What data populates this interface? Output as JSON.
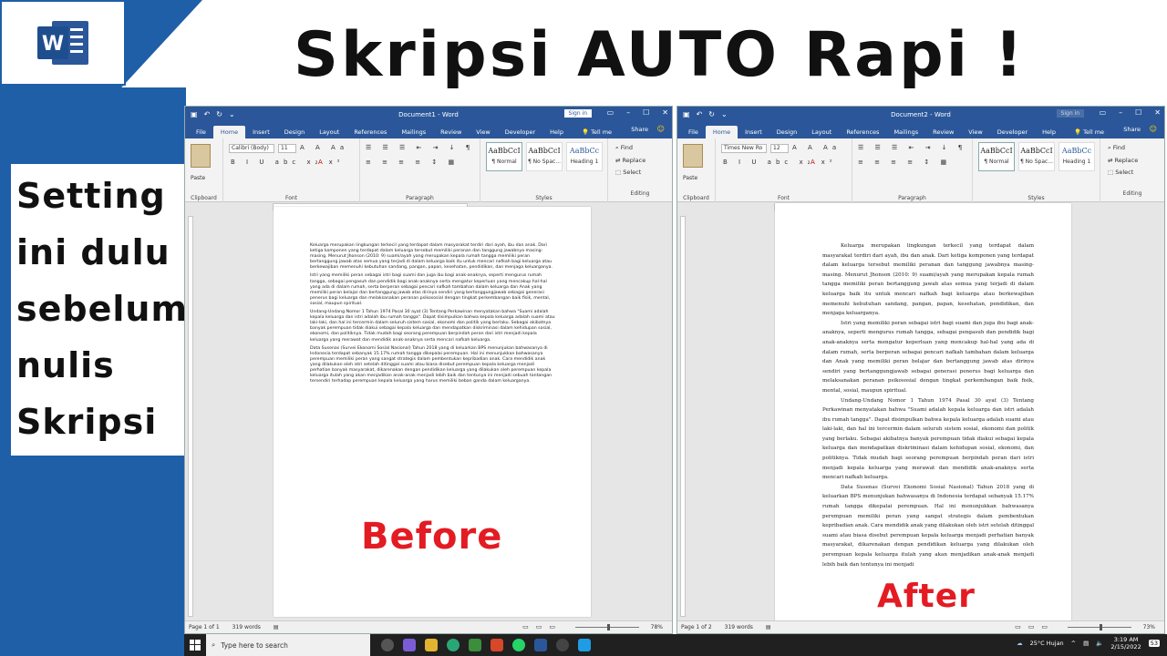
{
  "headline": "Skripsi AUTO Rapi !",
  "sidebar_lines": [
    "Setting",
    "ini dulu",
    "sebelum",
    "nulis",
    "Skripsi"
  ],
  "logo_letter": "W",
  "colors": {
    "word_blue": "#2b579a",
    "band_blue": "#1f5fa8",
    "label_red": "#e31b23",
    "taskbar": "#202020"
  },
  "ribbon_tabs": [
    "File",
    "Home",
    "Insert",
    "Design",
    "Layout",
    "References",
    "Mailings",
    "Review",
    "View",
    "Developer",
    "Help"
  ],
  "ribbon": {
    "tell_me": "Tell me",
    "share": "Share",
    "paste": "Paste",
    "groups": {
      "clipboard": "Clipboard",
      "font": "Font",
      "paragraph": "Paragraph",
      "styles": "Styles",
      "editing": "Editing"
    },
    "styles": [
      {
        "sample": "AaBbCcI",
        "name": "¶ Normal"
      },
      {
        "sample": "AaBbCcI",
        "name": "¶ No Spac..."
      },
      {
        "sample": "AaBbCc",
        "name": "Heading 1"
      }
    ],
    "editing": [
      "Find",
      "Replace",
      "Select"
    ],
    "font_icons": "B I U abc x₂ x²",
    "para_icons": "≡ ≡ ≡ ≡ ↕ ▦"
  },
  "windows": {
    "left": {
      "title": "Document1 - Word",
      "signin": "Sign in",
      "font": "Calibri (Body)",
      "size": "11",
      "status_page": "Page 1 of 1",
      "status_words": "319 words",
      "zoom": "78%",
      "label": "Before",
      "paragraphs": [
        "Keluarga merupakan lingkungan terkecil yang terdapat dalam masyarakat terdiri dari ayah, ibu dan anak. Dari ketiga komponen yang terdapat dalam keluarga tersebut memiliki peranan dan tanggung jawabnya masing-masing. Menurut Jhonson (2010: 9) suami/ayah yang merupakan kepala rumah tangga memiliki peran bertanggung jawab atas semua yang terjadi di dalam keluarga baik itu untuk mencari nafkah bagi keluarga atau berkewajiban memenuhi kebutuhan sandang, pangan, papan, kesehatan, pendidikan, dan menjaga keluarganya.",
        "Istri yang memiliki peran sebagai istri bagi suami dan juga ibu bagi anak-anaknya, seperti mengurus rumah tangga, sebagai pengasuh dan pendidik bagi anak-anaknya serta mengatur keperluan yang mencakup hal-hal yang ada di dalam rumah, serta berperan sebagai pencari nafkah tambahan dalam keluarga dan Anak yang memiliki peran belajar dan bertanggung jawab atas dirinya sendiri yang bertanggungjawab sebagai generasi penerus bagi keluarga dan melaksanakan peranan psikososial dengan tingkat perkembangan baik fisik, mental, sosial, maupun spiritual.",
        "Undang-Undang Nomor 1 Tahun 1974 Pasal 30 ayat (3) Tentang Perkawinan menyatakan bahwa \"Suami adalah kepala keluarga dan istri adalah ibu rumah tangga\". Dapat disimpulkan bahwa kepala keluarga adalah suami atau laki-laki, dan hal ini tercermin dalam seluruh sistem sosial, ekonomi dan politik yang berlaku. Sebagai akibatnya banyak perempuan tidak diakui sebagai kepala keluarga dan mendapatkan diskriminasi dalam kehidupan sosial, ekonomi, dan politiknya. Tidak mudah bagi seorang perempuan berpindah peran dari istri menjadi kepala keluarga yang merawat dan mendidik anak-anaknya serta mencari nafkah keluarga.",
        "Data Susenas (Survei Ekonomi Sosial Nasional) Tahun 2018 yang di keluarkan BPS menunjukan bahwasanya di Indonesia terdapat sebanyak 15.17% rumah tangga dikepalai perempuan. Hal ini menunjukkan bahwasanya perempuan memiliki peran yang sangat strategis dalam pembentukan kepribadian anak. Cara mendidik anak yang dilakukan oleh istri setelah ditinggal suami atau biasa disebut perempuan kepala keluarga menjadi perhatian banyak masyarakat, dikarenakan dengan pendidikan keluarga yang dilakukan oleh perempuan kepala keluarga itulah yang akan menjadikan anak-anak menjadi lebih baik dan tentunya ini menjadi sebuah tantangan tersendiri terhadap perempuan kepala keluarga yang harus memiliki beban ganda dalam keluarganya."
      ]
    },
    "right": {
      "title": "Document2 - Word",
      "signin": "Sign in",
      "font": "Times New Ro",
      "size": "12",
      "status_page": "Page 1 of 2",
      "status_words": "319 words",
      "zoom": "73%",
      "label": "After",
      "paragraphs": [
        "Keluarga merupakan lingkungan terkecil yang terdapat dalam masyarakat terdiri dari ayah, ibu dan anak. Dari ketiga komponen yang terdapat dalam keluarga tersebut memiliki peranan dan tanggung jawabnya masing-masing. Menurut Jhonson (2010: 9) suami/ayah yang merupakan kepala rumah tangga memiliki peran bertanggung jawab atas semua yang terjadi di dalam keluarga baik itu untuk mencari nafkah bagi keluarga atau berkewajiban memenuhi kebutuhan sandang, pangan, papan, kesehatan, pendidikan, dan menjaga keluarganya.",
        "Istri yang memiliki peran sebagai istri bagi suami dan juga ibu bagi anak-anaknya, seperti mengurus rumah tangga, sebagai pengasuh dan pendidik bagi anak-anaknya serta mengatur keperluan yang mencakup hal-hal yang ada di dalam rumah, serta berperan sebagai pencari nafkah tambahan dalam keluarga dan Anak yang memiliki peran belajar dan bertanggung jawab atas dirinya sendiri yang bertanggungjawab sebagai generasi penerus bagi keluarga dan melaksanakan peranan psikososial dengan tingkat perkembangan baik fisik, mental, sosial, maupun spiritual.",
        "Undang-Undang Nomor 1 Tahun 1974 Pasal 30 ayat (3) Tentang Perkawinan menyatakan bahwa \"Suami adalah kepala keluarga dan istri adalah ibu rumah tangga\". Dapat disimpulkan bahwa kepala keluarga adalah suami atau laki-laki, dan hal ini tercermin dalam seluruh sistem sosial, ekonomi dan politik yang berlaku. Sebagai akibatnya banyak perempuan tidak diakui sebagai kepala keluarga dan mendapatkan diskriminasi dalam kehidupan sosial, ekonomi, dan politiknya. Tidak mudah bagi seorang perempuan berpindah peran dari istri menjadi kepala keluarga yang merawat dan mendidik anak-anaknya serta mencari nafkah keluarga.",
        "Data Susenas (Survei Ekonomi Sosial Nasional) Tahun 2018 yang di keluarkan BPS menunjukan bahwasanya di Indonesia terdapat sebanyak 15.17% rumah tangga dikepalai perempuan. Hal ini menunjukkan bahwasanya perempuan memiliki peran yang sangat strategis dalam pembentukan kepribadian anak. Cara mendidik anak yang dilakukan oleh istri setelah ditinggal suami atau biasa disebut perempuan kepala keluarga menjadi perhatian banyak masyarakat, dikarenakan dengan pendidikan keluarga yang dilakukan oleh perempuan kepala keluarga itulah yang akan menjadikan anak-anak menjadi lebih baik dan tentunya ini menjadi"
      ]
    }
  },
  "taskbar": {
    "search_placeholder": "Type here to search",
    "weather": "25°C  Hujan",
    "time": "3:19 AM",
    "date": "2/15/2022",
    "notif_count": "53"
  }
}
